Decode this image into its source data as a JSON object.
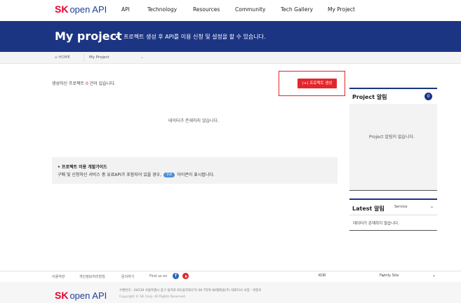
{
  "header": {
    "logo_sk": "SK",
    "logo_rest": "open API",
    "nav": [
      "API",
      "Technology",
      "Resources",
      "Community",
      "Tech Gallery",
      "My Project"
    ]
  },
  "banner": {
    "title": "My project",
    "description": "프로젝트 생성 후 API를 이용 신청 및 설정을 할 수 있습니다."
  },
  "breadcrumb": {
    "home": "HOME",
    "current": "My Project"
  },
  "main": {
    "count_prefix": "생성하신 프로젝트 ",
    "count_value": "0",
    "count_suffix": " 건이 있습니다.",
    "create_button": "(+) 프로젝트 생성",
    "empty_text": "데이터가 존재하지 않습니다.",
    "guide": {
      "title": "• 프로젝트 이용 개발가이드",
      "desc_before": "구매 및 신청하신 서비스 중 유료API가 포함되어 있을 경우,",
      "badge": "유료",
      "desc_after": "아이콘이 표시됩니다."
    }
  },
  "project_alarm": {
    "title": "Project 알림",
    "count": "0",
    "empty_text": "Project 알림이 없습니다."
  },
  "latest_alarm": {
    "title": "Latest 알림",
    "select_value": "Service",
    "empty_text": "데이터가 존재하지 않습니다."
  },
  "footer": {
    "links": [
      "이용약관",
      "개인정보처리방침",
      "문의하기"
    ],
    "find_us": "Find us on",
    "language_select": "KOR",
    "family_select": "Family Site",
    "logo_sk": "SK",
    "logo_rest": "open API",
    "address": "우편번호 : 04539 서울특별시 중구 을지로 65(을지로2가) SK T타워 SK텔레콤(주) 대표이사 사장 : 박정호",
    "copyright": "Copyright © SK Corp. All Rights Reserved."
  },
  "colors": {
    "brand_navy": "#1c3583",
    "brand_red": "#e4262c"
  }
}
